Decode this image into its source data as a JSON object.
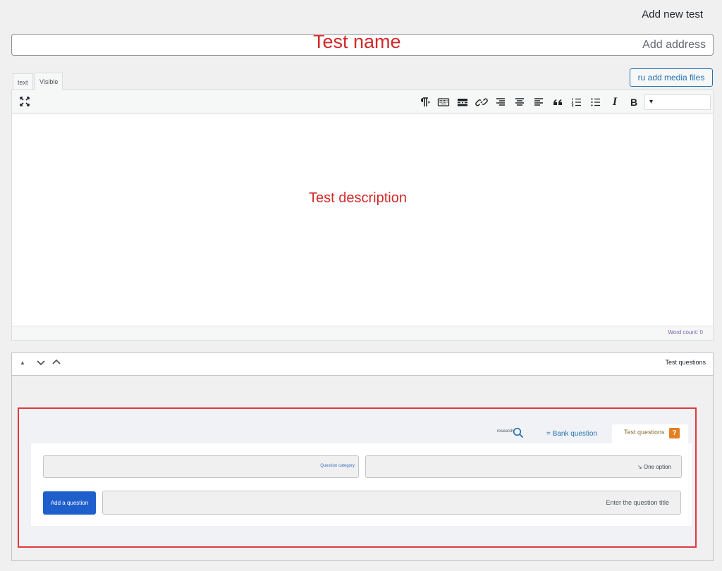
{
  "page": {
    "heading": "Add new test"
  },
  "title_field": {
    "placeholder": "Add address"
  },
  "annotations": {
    "name": "Test name",
    "description": "Test description"
  },
  "editor": {
    "tabs": [
      {
        "label": "text"
      },
      {
        "label": "Visible"
      }
    ],
    "media_button": "ru add media files",
    "toolbar": {
      "format_select": "▾",
      "icons": [
        {
          "name": "fullscreen-icon",
          "glyph": "⛶"
        },
        {
          "name": "rtl-icon",
          "glyph": "¶"
        },
        {
          "name": "keyboard-icon",
          "glyph": "⌨"
        },
        {
          "name": "more-tag-icon",
          "glyph": "▭"
        },
        {
          "name": "link-icon",
          "glyph": "🔗"
        },
        {
          "name": "align-right-icon",
          "glyph": "≡"
        },
        {
          "name": "align-center-icon",
          "glyph": "≡"
        },
        {
          "name": "align-left-icon",
          "glyph": "≡"
        },
        {
          "name": "blockquote-icon",
          "glyph": "❝"
        },
        {
          "name": "ordered-list-icon",
          "glyph": "⒈"
        },
        {
          "name": "unordered-list-icon",
          "glyph": "☰"
        },
        {
          "name": "italic-icon",
          "glyph": "I"
        },
        {
          "name": "bold-icon",
          "glyph": "B"
        }
      ]
    },
    "word_count": "Word count: 0"
  },
  "metabox": {
    "title": "Test questions",
    "controls": [
      {
        "glyph": "▲"
      },
      {
        "glyph": "⌄"
      },
      {
        "glyph": "⌃"
      }
    ]
  },
  "questions": {
    "tabs": {
      "research": "research",
      "bank": "= Bank question",
      "test": "Test questions",
      "help": "?"
    },
    "category_select": "Question category",
    "type_select": "↘ One option",
    "add_button": "Add a question",
    "title_input": {
      "placeholder": "Enter the question title"
    }
  },
  "colors": {
    "accent": "#2271b1",
    "primary_button": "#1f5fcc",
    "highlight_frame": "#e0393e",
    "help_badge": "#e67e22"
  }
}
